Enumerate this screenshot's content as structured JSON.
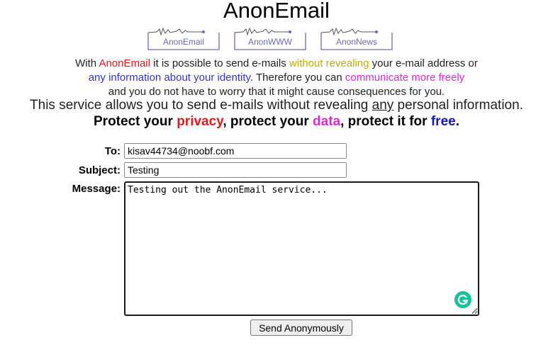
{
  "header": {
    "title": "AnonEmail",
    "nav": [
      {
        "label": "AnonEmail"
      },
      {
        "label": "AnonWWW"
      },
      {
        "label": "AnonNews"
      }
    ]
  },
  "intro": {
    "line1": {
      "a": "With ",
      "b": "AnonEmail",
      "c": " it is possible to send e-mails ",
      "d": "without revealing",
      "e": " your e-mail address or"
    },
    "line2": {
      "a": "any information about your identity",
      "b": ". Therefore you can ",
      "c": "communicate more freely"
    },
    "line3": "and you do not have to worry that it might cause consequences for you."
  },
  "service": {
    "a": "This service allows you to send e-mails without revealing ",
    "b": "any",
    "c": " personal information."
  },
  "protect": {
    "a": "Protect your ",
    "b": "privacy",
    "c": ", protect your ",
    "d": "data",
    "e": ", protect it for ",
    "f": "free",
    "g": "."
  },
  "form": {
    "to_label": "To:",
    "to_value": "kisav44734@noobf.com",
    "subject_label": "Subject:",
    "subject_value": "Testing",
    "message_label": "Message:",
    "message_value": "Testing out the AnonEmail service...",
    "send_label": "Send Anonymously"
  },
  "colors": {
    "red": "#e01919",
    "yellow": "#c4ad00",
    "blue": "#3434c4",
    "magenta": "#e026d6",
    "grammarly": "#15c39a"
  },
  "icons": {
    "grammarly": "grammarly-g-icon"
  }
}
